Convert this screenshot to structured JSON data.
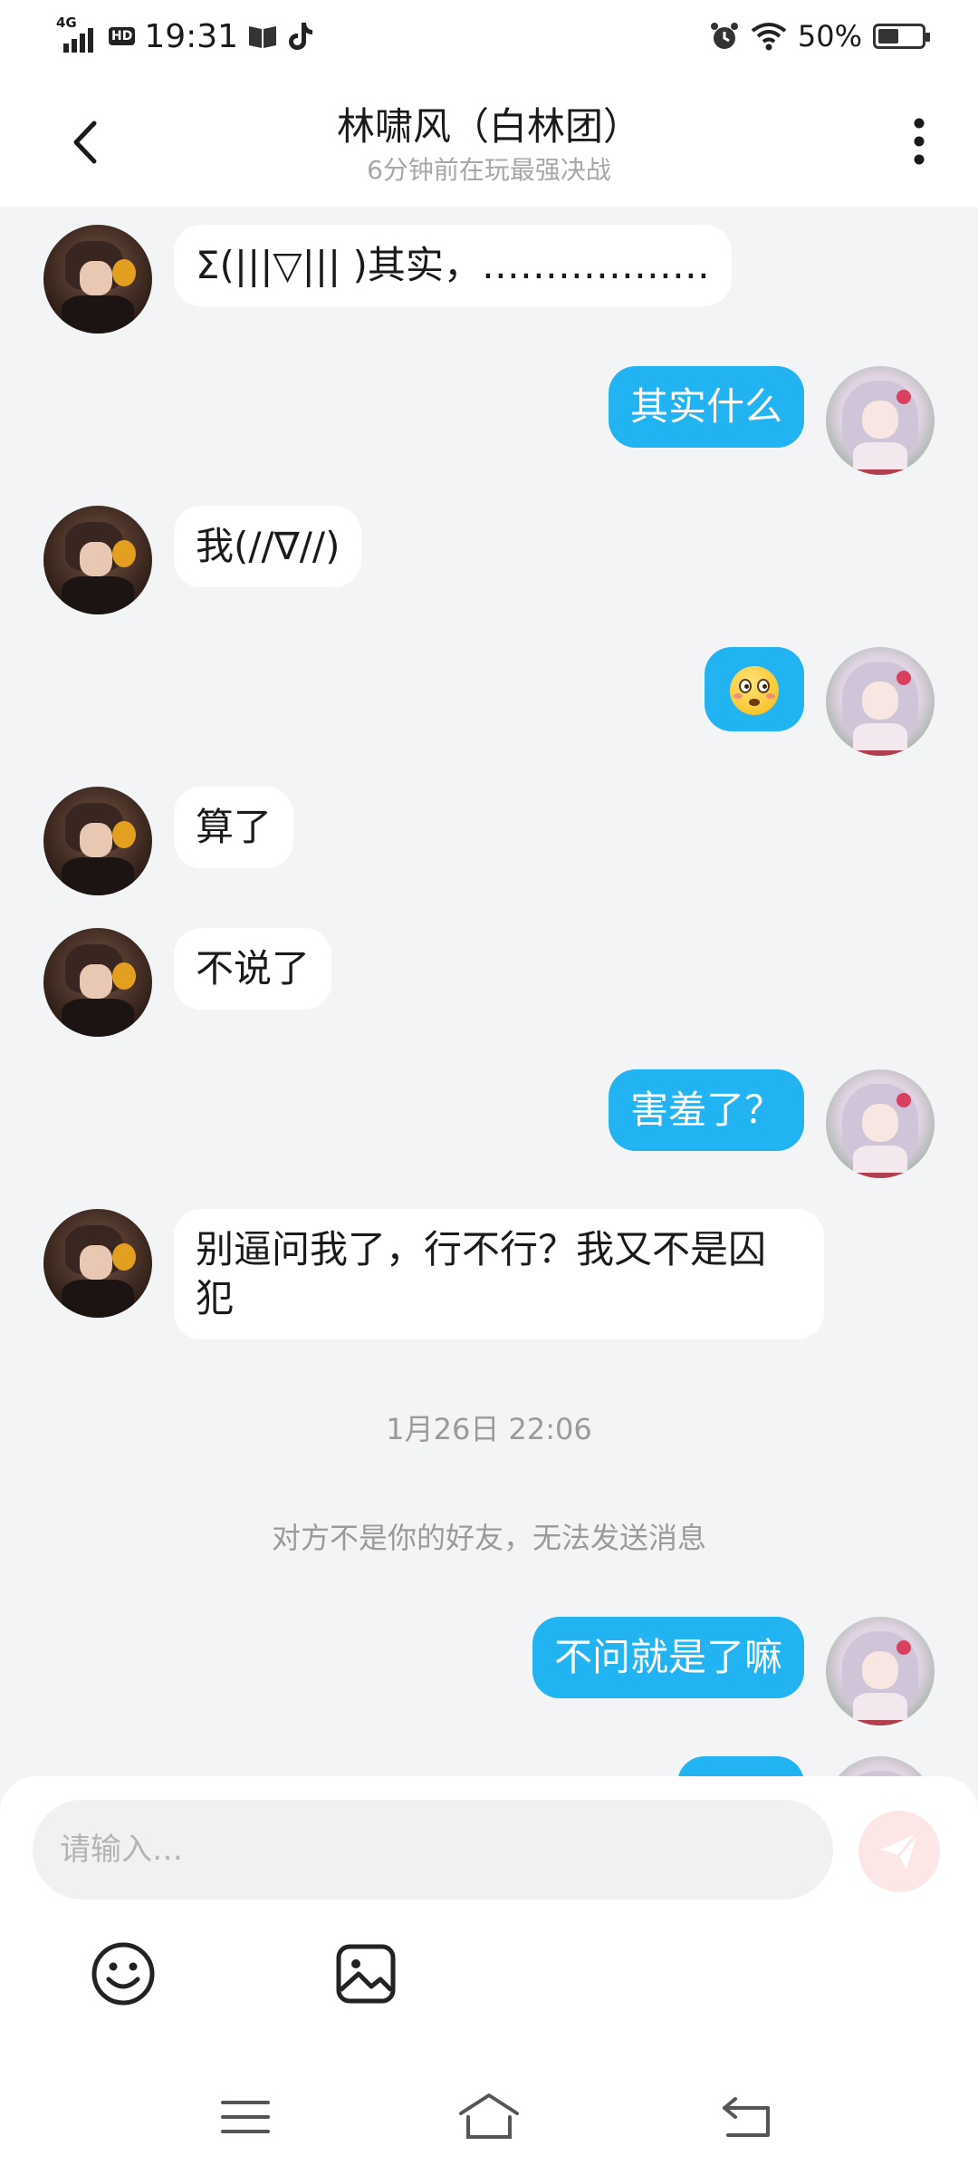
{
  "status_bar": {
    "network": "4G",
    "hd": "HD",
    "time": "19:31",
    "battery": "50%",
    "battery_level": 0.5
  },
  "header": {
    "title": "林啸风（白林团）",
    "subtitle": "6分钟前在玩最强决战"
  },
  "messages": [
    {
      "side": "in",
      "text": "Σ(|||▽||| )其实，………………"
    },
    {
      "side": "out",
      "text": "其实什么"
    },
    {
      "side": "in",
      "text": "我(//∇//)"
    },
    {
      "side": "out",
      "emoji": "flushed-face"
    },
    {
      "side": "in",
      "text": "算了"
    },
    {
      "side": "in",
      "text": "不说了"
    },
    {
      "side": "out",
      "text": "害羞了？"
    },
    {
      "side": "in",
      "text": "别逼问我了，行不行？我又不是囚犯"
    },
    {
      "side": "out",
      "text": "不问就是了嘛"
    }
  ],
  "system": {
    "timestamp": "1月26日  22:06",
    "notice": "对方不是你的好友，无法发送消息"
  },
  "input": {
    "placeholder": "请输入…"
  },
  "colors": {
    "outgoing_bubble": "#21b3f2",
    "incoming_bubble": "#ffffff",
    "background": "#f3f4f6",
    "send_button": "#fde6e6"
  }
}
